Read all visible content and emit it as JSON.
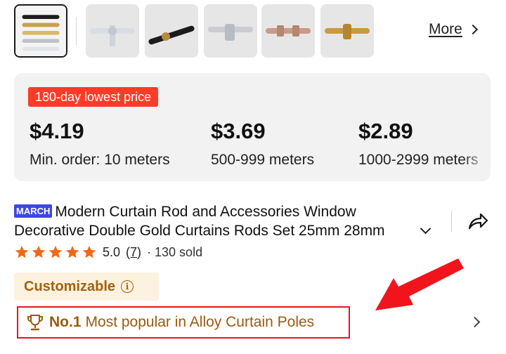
{
  "gallery": {
    "thumbnails": [
      {
        "name": "thumbnail-1-selected",
        "colors": [
          "#1e1e1e",
          "#c9a24a",
          "#bfc3c9"
        ]
      },
      {
        "name": "thumbnail-2",
        "colors": [
          "#d8dde3"
        ]
      },
      {
        "name": "thumbnail-3",
        "colors": [
          "#1b1b1b"
        ]
      },
      {
        "name": "thumbnail-4",
        "colors": [
          "#c9ccd1"
        ]
      },
      {
        "name": "thumbnail-5",
        "colors": [
          "#c99b86"
        ]
      },
      {
        "name": "thumbnail-6",
        "colors": [
          "#c99a3e"
        ]
      }
    ],
    "more_label": "More"
  },
  "pricing": {
    "badge": "180-day lowest price",
    "tiers": [
      {
        "price": "$4.19",
        "qty": "Min. order: 10 meters"
      },
      {
        "price": "$3.69",
        "qty": "500-999 meters"
      },
      {
        "price": "$2.89",
        "qty": "1000-2999 meters"
      }
    ]
  },
  "product": {
    "promo_badge": "MARCH",
    "title_line1": "Modern Curtain Rod and Accessories Window",
    "title_line2": "Decorative Double Gold Curtains Rods Set 25mm 28mm",
    "rating": "5.0",
    "reviews": "(7)",
    "sold": "· 130 sold",
    "stars": 5,
    "customizable_label": "Customizable",
    "info_glyph": "i",
    "ranking": {
      "rank": "No.1",
      "text": "Most popular in Alloy Curtain Poles"
    }
  },
  "colors": {
    "badge_red": "#fe3b26",
    "star_orange": "#ef6a16",
    "highlight_red": "#e8141f",
    "accent_brown": "#9a5b10"
  }
}
